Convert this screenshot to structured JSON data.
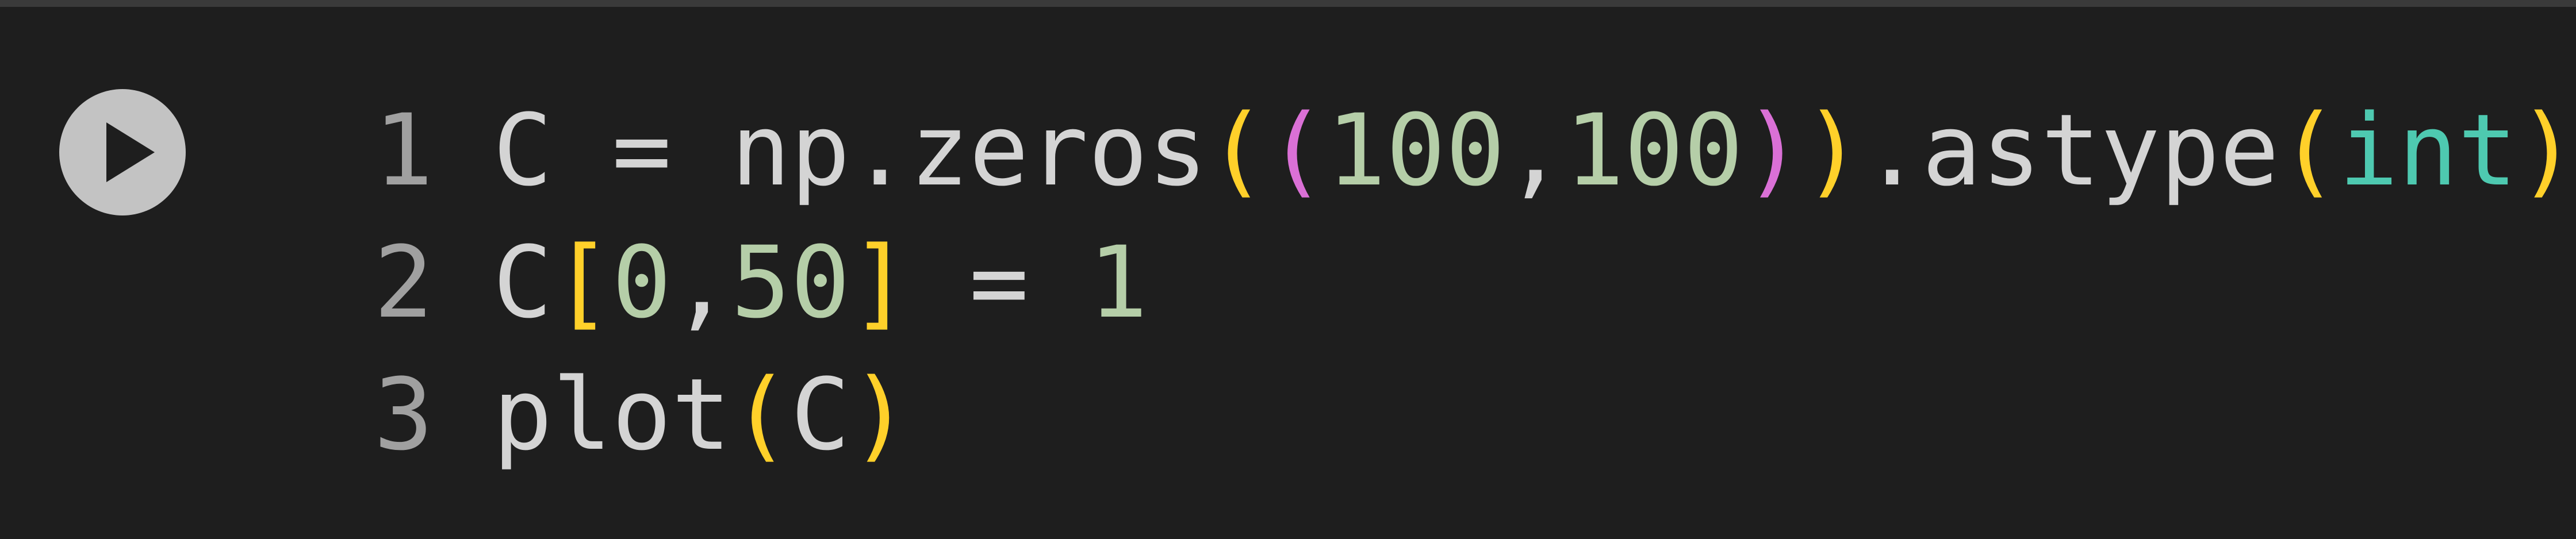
{
  "colors": {
    "background": "#1e1e1e",
    "top_border": "#3a3a3a",
    "run_button": "#c3c3c3",
    "run_icon": "#1e1e1e",
    "line_number": "#a0a0a0",
    "default_text": "#d4d4d4",
    "number": "#b5cea8",
    "bracket_level_1": "#ffd02a",
    "bracket_level_2": "#da70d6",
    "builtin": "#4ec9b0"
  },
  "cell": {
    "run_button_icon": "play-icon",
    "lines": [
      {
        "number": "1",
        "tokens": [
          {
            "text": "C = np.zeros",
            "type": "default"
          },
          {
            "text": "(",
            "type": "paren-1"
          },
          {
            "text": "(",
            "type": "paren-2"
          },
          {
            "text": "100",
            "type": "number"
          },
          {
            "text": ",",
            "type": "default"
          },
          {
            "text": "100",
            "type": "number"
          },
          {
            "text": ")",
            "type": "paren-2"
          },
          {
            "text": ")",
            "type": "paren-1"
          },
          {
            "text": ".astype",
            "type": "default"
          },
          {
            "text": "(",
            "type": "paren-1"
          },
          {
            "text": "int",
            "type": "builtin"
          },
          {
            "text": ")",
            "type": "paren-1"
          }
        ]
      },
      {
        "number": "2",
        "tokens": [
          {
            "text": "C",
            "type": "default"
          },
          {
            "text": "[",
            "type": "paren-1"
          },
          {
            "text": "0",
            "type": "number"
          },
          {
            "text": ",",
            "type": "default"
          },
          {
            "text": "50",
            "type": "number"
          },
          {
            "text": "]",
            "type": "paren-1"
          },
          {
            "text": " = ",
            "type": "default"
          },
          {
            "text": "1",
            "type": "number"
          }
        ]
      },
      {
        "number": "3",
        "tokens": [
          {
            "text": "plot",
            "type": "default"
          },
          {
            "text": "(",
            "type": "paren-1"
          },
          {
            "text": "C",
            "type": "default"
          },
          {
            "text": ")",
            "type": "paren-1"
          }
        ]
      }
    ]
  }
}
